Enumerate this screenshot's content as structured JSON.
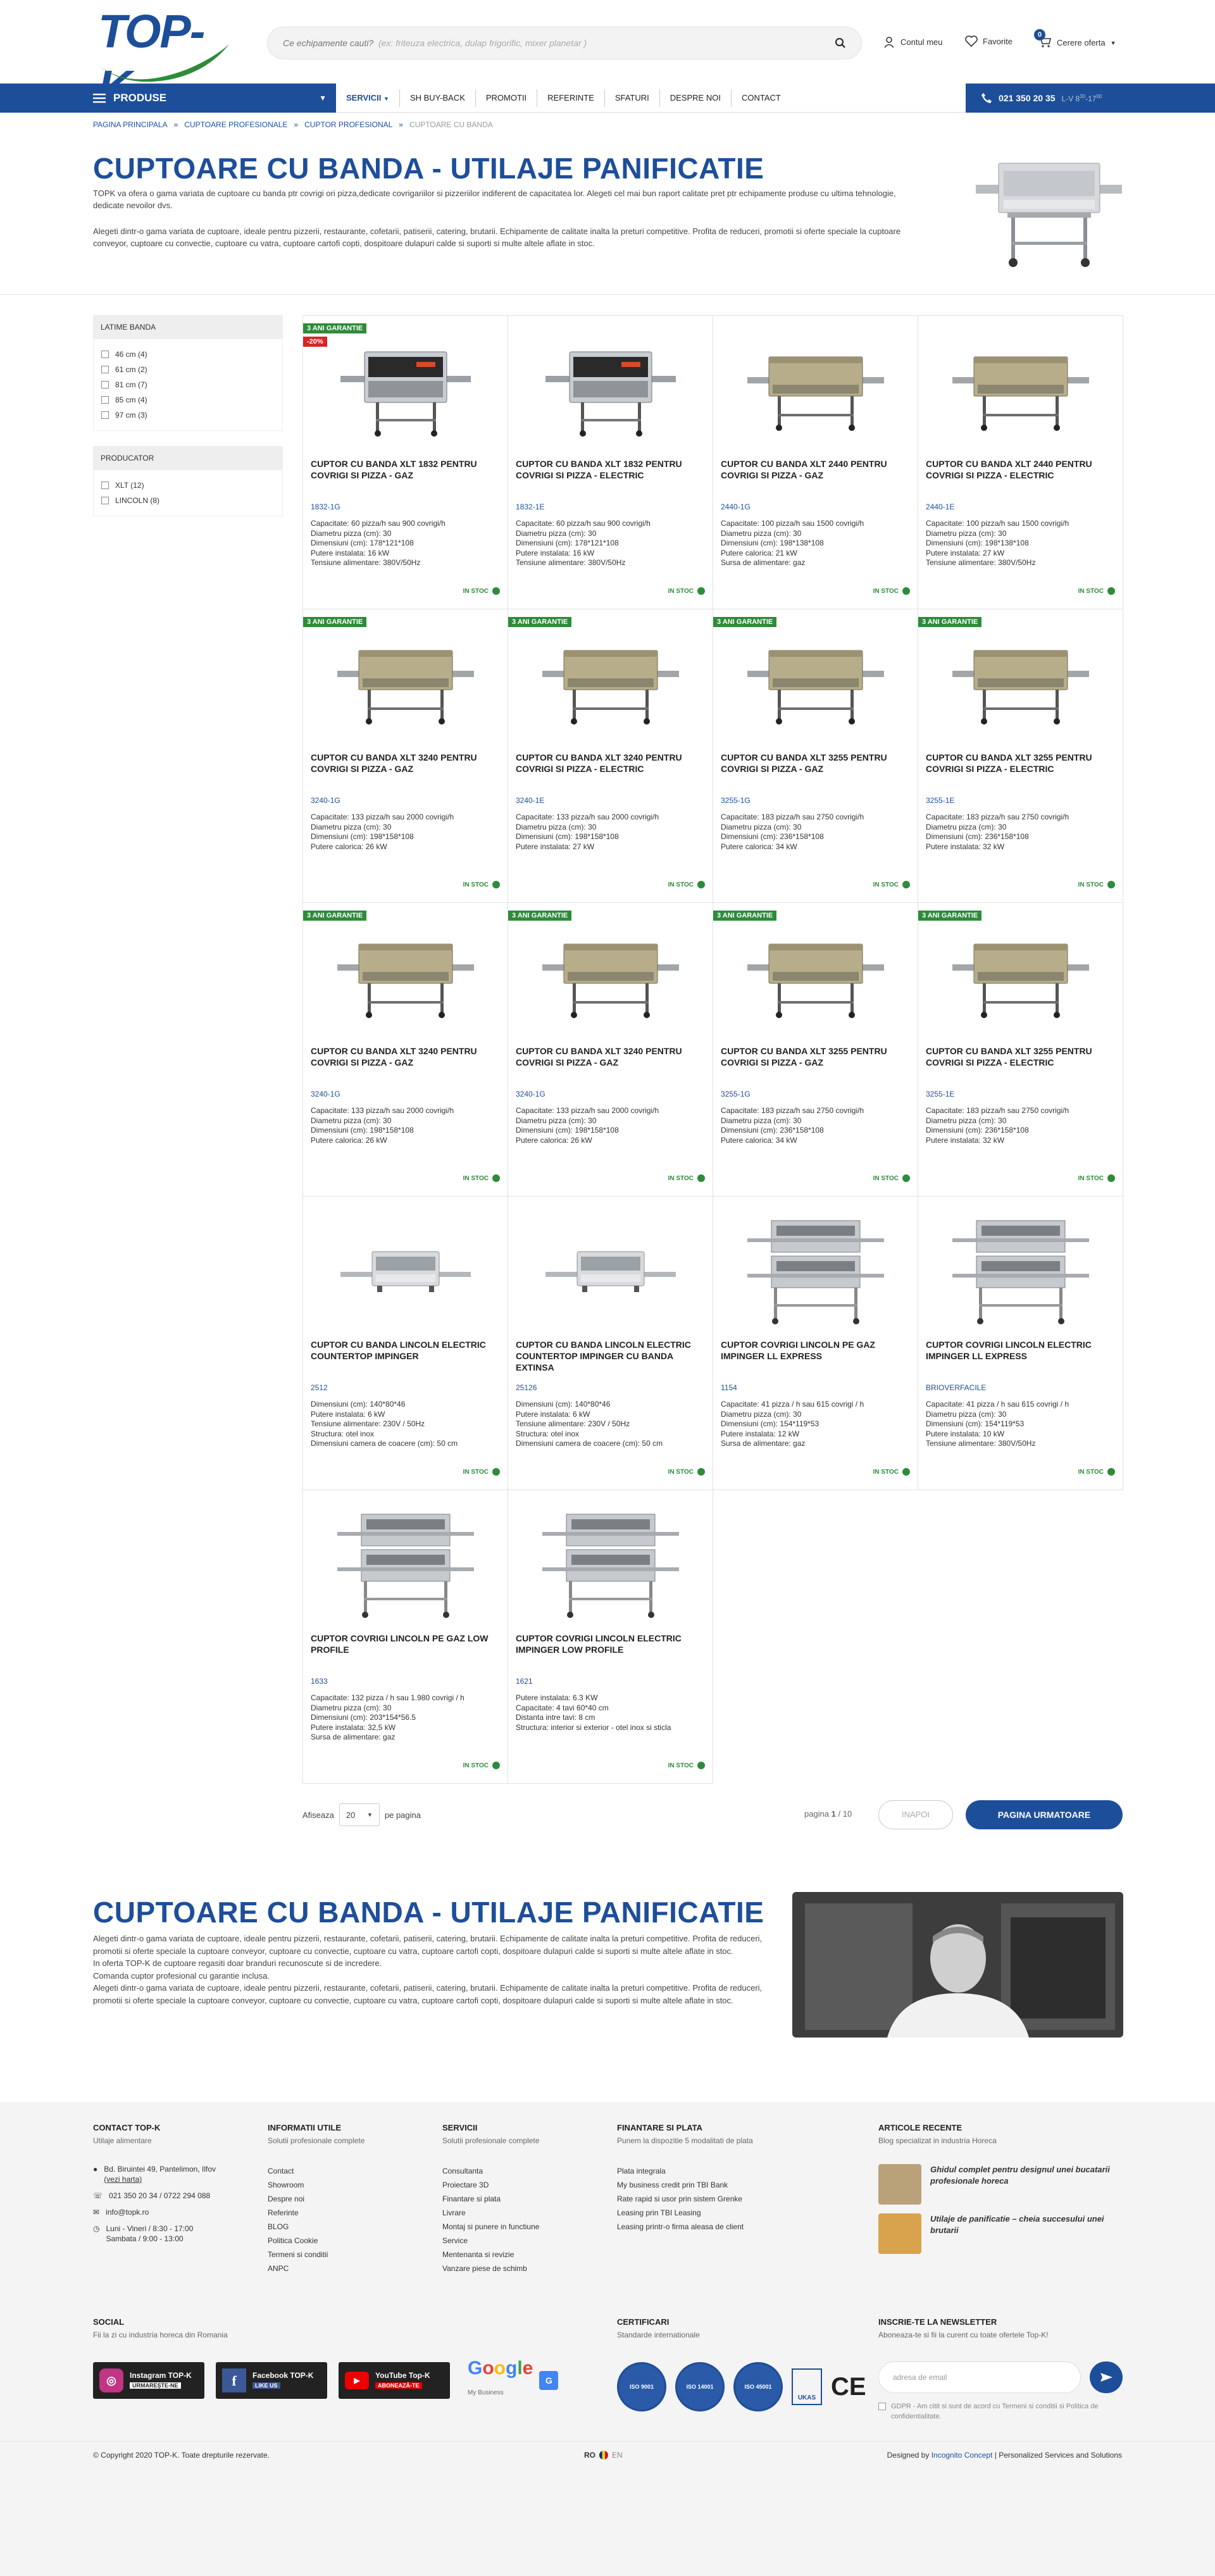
{
  "header": {
    "logo_text": "TOP-K",
    "search_placeholder": "Ce echipamente cauti?",
    "search_hint": "(ex: friteuza electrica, dulap frigorific, mixer planetar )",
    "account_label": "Contul meu",
    "favorites_label": "Favorite",
    "cart_label": "Cerere oferta",
    "cart_count": "0"
  },
  "nav": {
    "products_label": "PRODUSE",
    "items": [
      {
        "label": "SERVICII"
      },
      {
        "label": "SH BUY-BACK"
      },
      {
        "label": "PROMOTII"
      },
      {
        "label": "REFERINTE"
      },
      {
        "label": "SFATURI"
      },
      {
        "label": "DESPRE NOI"
      },
      {
        "label": "CONTACT"
      }
    ],
    "phone": "021 350 20 35",
    "hours": "L-V 8"
  },
  "breadcrumb": [
    "PAGINA PRINCIPALA",
    "CUPTOARE PROFESIONALE",
    "CUPTOR PROFESIONAL",
    "CUPTOARE CU BANDA"
  ],
  "intro": {
    "title": "CUPTOARE CU BANDA - UTILAJE PANIFICATIE",
    "p1": "TOPK va ofera o gama variata de cuptoare cu banda ptr covrigi ori pizza,dedicate covrigariilor si pizzeriilor indiferent de capacitatea lor. Alegeti cel mai bun raport calitate pret ptr echipamente produse cu ultima tehnologie, dedicate nevoilor dvs.",
    "p2": "Alegeti dintr-o gama variata de cuptoare, ideale pentru pizzerii, restaurante, cofetarii, patiserii, catering, brutarii. Echipamente de calitate inalta la preturi competitive. Profita de reduceri, promotii si oferte speciale la cuptoare conveyor, cuptoare cu convectie, cuptoare cu vatra, cuptoare cartofi copti, dospitoare dulapuri calde si suporti si multe altele aflate in stoc."
  },
  "filters": [
    {
      "title": "LATIME BANDA",
      "options": [
        "46 cm (4)",
        "61 cm (2)",
        "81 cm (7)",
        "85 cm (4)",
        "97 cm (3)"
      ]
    },
    {
      "title": "PRODUCATOR",
      "options": [
        "XLT (12)",
        "LINCOLN (8)"
      ]
    }
  ],
  "products": [
    {
      "tag": "3 ANI GARANTIE",
      "discount": "-20%",
      "name": "CUPTOR CU BANDA XLT 1832 PENTRU COVRIGI SI PIZZA - GAZ",
      "code": "1832-1G",
      "specs": "Capacitate: 60 pizza/h sau 900 covrigi/h\nDiametru pizza (cm): 30\nDimensiuni (cm): 178*121*108\nPutere instalata: 16 kW\nTensiune alimentare: 380V/50Hz",
      "stock": "IN STOC",
      "img": "xlt"
    },
    {
      "tag": "",
      "discount": "",
      "name": "CUPTOR CU BANDA XLT 1832 PENTRU COVRIGI SI PIZZA - ELECTRIC",
      "code": "1832-1E",
      "specs": "Capacitate: 60 pizza/h sau 900 covrigi/h\nDiametru pizza (cm): 30\nDimensiuni (cm): 178*121*108\nPutere instalata: 16 kW\nTensiune alimentare: 380V/50Hz",
      "stock": "IN STOC",
      "img": "xlt"
    },
    {
      "tag": "",
      "discount": "",
      "name": "CUPTOR CU BANDA XLT 2440 PENTRU COVRIGI SI PIZZA - GAZ",
      "code": "2440-1G",
      "specs": "Capacitate: 100 pizza/h sau 1500 covrigi/h\nDiametru pizza (cm): 30\nDimensiuni (cm): 198*138*108\nPutere calorica: 21 kW\nSursa de alimentare: gaz",
      "stock": "IN STOC",
      "img": "xltb"
    },
    {
      "tag": "",
      "discount": "",
      "name": "CUPTOR CU BANDA XLT 2440 PENTRU COVRIGI SI PIZZA - ELECTRIC",
      "code": "2440-1E",
      "specs": "Capacitate: 100 pizza/h sau 1500 covrigi/h\nDiametru pizza (cm): 30\nDimensiuni (cm): 198*138*108\nPutere instalata: 27 kW\nTensiune alimentare: 380V/50Hz",
      "stock": "IN STOC",
      "img": "xltb"
    },
    {
      "tag": "3 ANI GARANTIE",
      "discount": "",
      "name": "CUPTOR CU BANDA XLT 3240 PENTRU COVRIGI SI PIZZA - GAZ",
      "code": "3240-1G",
      "specs": "Capacitate: 133 pizza/h sau 2000 covrigi/h\nDiametru pizza (cm): 30\nDimensiuni (cm): 198*158*108\nPutere calorica: 26 kW",
      "stock": "IN STOC",
      "img": "xltb"
    },
    {
      "tag": "3 ANI GARANTIE",
      "discount": "",
      "name": "CUPTOR CU BANDA XLT 3240 PENTRU COVRIGI SI PIZZA - ELECTRIC",
      "code": "3240-1E",
      "specs": "Capacitate: 133 pizza/h sau 2000 covrigi/h\nDiametru pizza (cm): 30\nDimensiuni (cm): 198*158*108\nPutere instalata: 27 kW",
      "stock": "IN STOC",
      "img": "xltb"
    },
    {
      "tag": "3 ANI GARANTIE",
      "discount": "",
      "name": "CUPTOR CU BANDA XLT 3255 PENTRU COVRIGI SI PIZZA - GAZ",
      "code": "3255-1G",
      "specs": "Capacitate: 183 pizza/h sau 2750 covrigi/h\nDiametru pizza (cm): 30\nDimensiuni (cm): 236*158*108\nPutere calorica: 34 kW",
      "stock": "IN STOC",
      "img": "xltb"
    },
    {
      "tag": "3 ANI GARANTIE",
      "discount": "",
      "name": "CUPTOR CU BANDA XLT 3255 PENTRU COVRIGI SI PIZZA - ELECTRIC",
      "code": "3255-1E",
      "specs": "Capacitate: 183 pizza/h sau 2750 covrigi/h\nDiametru pizza (cm): 30\nDimensiuni (cm): 236*158*108\nPutere instalata: 32 kW",
      "stock": "IN STOC",
      "img": "xltb"
    },
    {
      "tag": "3 ANI GARANTIE",
      "discount": "",
      "name": "CUPTOR CU BANDA XLT 3240 PENTRU COVRIGI SI PIZZA - GAZ",
      "code": "3240-1G",
      "specs": "Capacitate: 133 pizza/h sau 2000 covrigi/h\nDiametru pizza (cm): 30\nDimensiuni (cm): 198*158*108\nPutere calorica: 26 kW",
      "stock": "IN STOC",
      "img": "xltb"
    },
    {
      "tag": "3 ANI GARANTIE",
      "discount": "",
      "name": "CUPTOR CU BANDA XLT 3240 PENTRU COVRIGI SI PIZZA - GAZ",
      "code": "3240-1G",
      "specs": "Capacitate: 133 pizza/h sau 2000 covrigi/h\nDiametru pizza (cm): 30\nDimensiuni (cm): 198*158*108\nPutere calorica: 26 kW",
      "stock": "IN STOC",
      "img": "xltb"
    },
    {
      "tag": "3 ANI GARANTIE",
      "discount": "",
      "name": "CUPTOR CU BANDA XLT 3255 PENTRU COVRIGI SI PIZZA - GAZ",
      "code": "3255-1G",
      "specs": "Capacitate: 183 pizza/h sau 2750 covrigi/h\nDiametru pizza (cm): 30\nDimensiuni (cm): 236*158*108\nPutere calorica: 34 kW",
      "stock": "IN STOC",
      "img": "xltb"
    },
    {
      "tag": "3 ANI GARANTIE",
      "discount": "",
      "name": "CUPTOR CU BANDA XLT 3255 PENTRU COVRIGI SI PIZZA - ELECTRIC",
      "code": "3255-1E",
      "specs": "Capacitate: 183 pizza/h sau 2750 covrigi/h\nDiametru pizza (cm): 30\nDimensiuni (cm): 236*158*108\nPutere instalata: 32 kW",
      "stock": "IN STOC",
      "img": "xltb"
    },
    {
      "tag": "",
      "discount": "",
      "name": "CUPTOR CU BANDA LINCOLN ELECTRIC COUNTERTOP IMPINGER",
      "code": "2512",
      "specs": "Dimensiuni (cm): 140*80*46\nPutere instalata: 6 kW\nTensiune alimentare: 230V / 50Hz\nStructura: otel inox\nDimensiuni camera de coacere (cm): 50 cm",
      "stock": "IN STOC",
      "img": "lincs"
    },
    {
      "tag": "",
      "discount": "",
      "name": "CUPTOR CU BANDA LINCOLN ELECTRIC COUNTERTOP IMPINGER CU BANDA EXTINSA",
      "code": "25126",
      "specs": "Dimensiuni (cm): 140*80*46\nPutere instalata: 6 kW\nTensiune alimentare: 230V / 50Hz\nStructura: otel inox\nDimensiuni camera de coacere (cm): 50 cm",
      "stock": "IN STOC",
      "img": "lincs"
    },
    {
      "tag": "",
      "discount": "",
      "name": "CUPTOR COVRIGI LINCOLN PE GAZ IMPINGER LL EXPRESS",
      "code": "1154",
      "specs": "Capacitate: 41 pizza / h sau 615 covrigi / h\nDiametru pizza (cm): 30\nDimensiuni (cm): 154*119*53\nPutere instalata: 12 kW\nSursa de alimentare: gaz",
      "stock": "IN STOC",
      "img": "lincd"
    },
    {
      "tag": "",
      "discount": "",
      "name": "CUPTOR COVRIGI LINCOLN ELECTRIC IMPINGER LL EXPRESS",
      "code": "BRIOVERFACILE",
      "specs": "Capacitate: 41 pizza / h sau 615 covrigi / h\nDiametru pizza (cm): 30\nDimensiuni (cm): 154*119*53\nPutere instalata: 10 kW\nTensiune alimentare: 380V/50Hz",
      "stock": "IN STOC",
      "img": "lincd"
    },
    {
      "tag": "",
      "discount": "",
      "name": "CUPTOR COVRIGI LINCOLN PE GAZ LOW PROFILE",
      "code": "1633",
      "specs": "Capacitate: 132 pizza / h sau 1.980 covrigi / h\nDiametru pizza (cm): 30\nDimensiuni (cm): 203*154*56.5\nPutere instalata: 32,5 kW\nSursa de alimentare: gaz",
      "stock": "IN STOC",
      "img": "lincd"
    },
    {
      "tag": "",
      "discount": "",
      "name": "CUPTOR COVRIGI LINCOLN ELECTRIC IMPINGER LOW PROFILE",
      "code": "1621",
      "specs": "Putere instalata: 6.3 KW\nCapacitate: 4 tavi 60*40 cm\nDistanta intre tavi: 8 cm\nStructura: interior si exterior - otel inox si sticla",
      "stock": "IN STOC",
      "img": "lincd"
    }
  ],
  "pagination": {
    "show_label": "Afiseaza",
    "per_page_value": "20",
    "per_page_label": "pe pagina",
    "page_prefix": "pagina",
    "page_current": "1",
    "page_total": "/ 10",
    "prev_label": "INAPOI",
    "next_label": "PAGINA URMATOARE"
  },
  "seo": {
    "title": "CUPTOARE CU BANDA - UTILAJE PANIFICATIE",
    "p1": "Alegeti dintr-o gama variata de cuptoare, ideale pentru pizzerii, restaurante, cofetarii, patiserii, catering, brutarii. Echipamente de calitate inalta la preturi competitive. Profita de reduceri, promotii si oferte speciale la cuptoare conveyor, cuptoare cu convectie, cuptoare cu vatra, cuptoare cartofi copti, dospitoare dulapuri calde si suporti si multe altele aflate in stoc.",
    "p2": "In oferta TOP-K de cuptoare regasiti doar branduri recunoscute si de incredere.",
    "p3": "Comanda cuptor profesional cu garantie inclusa.",
    "p4": "Alegeti dintr-o gama variata de cuptoare, ideale pentru pizzerii, restaurante, cofetarii, patiserii, catering, brutarii. Echipamente de calitate inalta la preturi competitive. Profita de reduceri, promotii si oferte speciale la cuptoare conveyor, cuptoare cu convectie, cuptoare cu vatra, cuptoare cartofi copti, dospitoare dulapuri calde si suporti si multe altele aflate in stoc."
  },
  "footer": {
    "contact": {
      "title": "CONTACT TOP-K",
      "sub": "Utilaje alimentare",
      "address": "Bd. Biruintei 49, Pantelimon, Ilfov",
      "map_link": "(vezi harta)",
      "phones": "021 350 20 34  /  0722 294 088",
      "email": "info@topk.ro",
      "hours1": "Luni - Vineri / 8:30 - 17:00",
      "hours2": "Sambata / 9:00 - 13:00"
    },
    "info": {
      "title": "INFORMATII UTILE",
      "sub": "Solutii profesionale complete",
      "links": [
        "Contact",
        "Showroom",
        "Despre noi",
        "Referinte",
        "BLOG",
        "Politica Cookie",
        "Termeni si conditii",
        "ANPC"
      ]
    },
    "services": {
      "title": "SERVICII",
      "sub": "Solutii profesionale complete",
      "links": [
        "Consultanta",
        "Proiectare 3D",
        "Finantare si plata",
        "Livrare",
        "Montaj si punere in functiune",
        "Service",
        "Mentenanta si revizie",
        "Vanzare piese de schimb"
      ]
    },
    "finance": {
      "title": "FINANTARE SI PLATA",
      "sub": "Punem la dispozitie 5 modalitati de plata",
      "links": [
        "Plata integrala",
        "My business credit prin TBI Bank",
        "Rate rapid si usor prin sistem Grenke",
        "Leasing prin TBI Leasing",
        "Leasing printr-o firma aleasa de client"
      ]
    },
    "articles": {
      "title": "ARTICOLE RECENTE",
      "sub": "Blog specializat in industria Horeca",
      "items": [
        "Ghidul complet pentru designul unei bucatarii profesionale horeca",
        "Utilaje de panificatie – cheia succesului unei brutarii"
      ]
    },
    "social": {
      "title": "SOCIAL",
      "sub": "Fii la zi cu industria horeca din Romania",
      "instagram": "Instagram TOP-K",
      "instagram_btn": "URMAREȘTE-NE",
      "facebook": "Facebook TOP-K",
      "facebook_btn": "LIKE US",
      "youtube": "YouTube Top-K",
      "youtube_btn": "ABONEAZĂ-TE",
      "google_sub": "My Business"
    },
    "certs": {
      "title": "CERTIFICARI",
      "sub": "Standarde internationale",
      "items": [
        "ISO 9001",
        "ISO 14001",
        "ISO 45001"
      ],
      "ukas": "UKAS",
      "ce": "CE"
    },
    "newsletter": {
      "title": "INSCRIE-TE LA NEWSLETTER",
      "sub": "Aboneaza-te si fii la curent cu toate ofertele Top-K!",
      "placeholder": "adresa de email",
      "gdpr": "GDPR - Am citit si sunt de acord cu Termeni si conditii si Politica de confidentialitate."
    },
    "copyright": "© Copyright 2020 TOP-K. Toate drepturile rezervate.",
    "lang_ro": "RO",
    "lang_en": "EN",
    "designed_prefix": "Designed by",
    "designed_by": "Incognito Concept",
    "designed_suffix": "| Personalized Services and Solutions"
  }
}
